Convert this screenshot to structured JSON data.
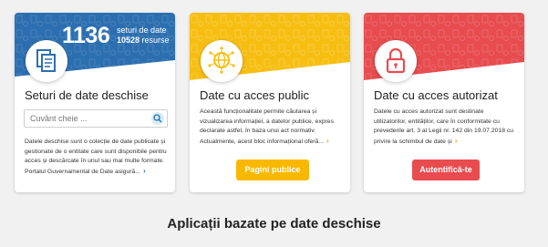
{
  "colors": {
    "blue": "#2c6fb0",
    "yellow": "#f7be12",
    "red": "#e74c4f",
    "button_yellow": "#f9b800",
    "button_red": "#e84c4f",
    "page_background": "#f1f1f1"
  },
  "open_data": {
    "dataset_count": "1136",
    "dataset_label": "seturi de date",
    "resource_count": "10528",
    "resource_label": "resurse",
    "icon": "documents-icon",
    "title": "Seturi de date deschise",
    "search_placeholder": "Cuvânt cheie ...",
    "search_icon": "search-icon",
    "description": "Datele deschise sunt o colecție de date publicate și gestionate de o entitate care sunt disponibile pentru acces și descărcate în unul sau mai multe formate. Portalul Guvernamental de Date asigură...",
    "more_glyph": "›"
  },
  "public_access": {
    "icon": "globe-network-icon",
    "title": "Date cu acces public",
    "description": "Această funcționalitate permite căutarea și vizualizarea informației, a datelor publice, expres declarate astfel, în baza unui act normativ. Actualmente, acest bloc informațional oferă...",
    "more_glyph": "›",
    "button_label": "Pagini publice"
  },
  "authorized_access": {
    "icon": "lock-icon",
    "title": "Date cu acces autorizat",
    "description": "Datele cu acces autorizat sunt destinate utilizatorilor, entităților, care în conformitate cu prevederile art. 3 al Legii nr. 142 din 19.07.2018 cu privire la schimbul de date și",
    "more_glyph": "›",
    "button_label": "Autentifică-te"
  },
  "section_heading": "Aplicații bazate pe date deschise"
}
